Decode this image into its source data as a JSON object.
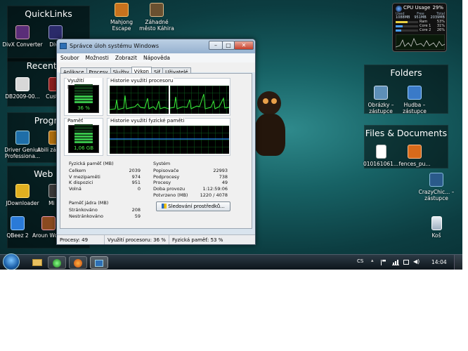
{
  "desktop": {
    "fences": {
      "quicklinks": "QuickLinks",
      "recent": "Recent Th",
      "programs": "Progra",
      "weblinks": "Web Li",
      "folders": "Folders",
      "files": "Files & Documents"
    },
    "icons": {
      "divx_converter": "DivX Converter",
      "divx2": "DivX",
      "mahjong": "Mahjong Escape",
      "zahadne": "Záhadné město Káhira",
      "db2009": "DB2009-00...",
      "custom": "Cust Fe",
      "driver_genius": "Driver Genius Professiona...",
      "abil": "Abili zástupce",
      "jdownloader": "JDownloader",
      "mi_fir": "Mi Fir",
      "qbeez": "QBeez 2",
      "around": "Aroun World",
      "obrazky": "Obrázky – zástupce",
      "hudba": "Hudba – zástupce",
      "file010": "010161061...",
      "fences_pu": "fences_pu...",
      "crazychic": "CrazyChic... – zástupce",
      "kos": "Koš"
    }
  },
  "cpu_gadget": {
    "title": "CPU Usage",
    "total_pct": "29%",
    "used_label": "Used",
    "free_label": "Free",
    "total_label": "Total",
    "used_val": "1088MB",
    "free_val": "951MB",
    "total_val": "2039MB",
    "ram_label": "Ram",
    "ram_pct": "53%",
    "core1_label": "Core 1",
    "core1_pct": "31%",
    "core2_label": "Core 2",
    "core2_pct": "26%",
    "ram_fill": 0.53,
    "core1_fill": 0.31,
    "core2_fill": 0.26
  },
  "window": {
    "title": "Správce úloh systému Windows",
    "menu": [
      "Soubor",
      "Možnosti",
      "Zobrazit",
      "Nápověda"
    ],
    "tabs": [
      "Aplikace",
      "Procesy",
      "Služby",
      "Výkon",
      "Síť",
      "Uživatelé"
    ],
    "active_tab": "Výkon",
    "groups": {
      "cpu_usage": "Využití procesoru",
      "cpu_history": "Historie využití procesoru",
      "memory": "Paměť",
      "mem_history": "Historie využití fyzické paměti"
    },
    "cpu_value": "36 %",
    "mem_value": "1,06 GB",
    "cpu_fill": 0.36,
    "mem_fill": 0.53,
    "physical": {
      "header": "Fyzická paměť (MB)",
      "rows": [
        {
          "label": "Celkem",
          "value": "2039"
        },
        {
          "label": "V mezipaměti",
          "value": "974"
        },
        {
          "label": "K dispozici",
          "value": "951"
        },
        {
          "label": "Volná",
          "value": "0"
        }
      ]
    },
    "kernel": {
      "header": "Paměť jádra (MB)",
      "rows": [
        {
          "label": "Stránkováno",
          "value": "208"
        },
        {
          "label": "Nestránkováno",
          "value": "59"
        }
      ]
    },
    "system": {
      "header": "Systém",
      "rows": [
        {
          "label": "Popisovače",
          "value": "22993"
        },
        {
          "label": "Podprocesy",
          "value": "738"
        },
        {
          "label": "Procesy",
          "value": "49"
        },
        {
          "label": "Doba provozu",
          "value": "1:12:59:06"
        },
        {
          "label": "Potvrzeno (MB)",
          "value": "1220 / 4078"
        }
      ]
    },
    "monitor_button": "Sledování prostředků...",
    "status": {
      "processes": "Procesy: 49",
      "cpu": "Využití procesoru: 36 %",
      "memory": "Fyzická paměť: 53 %"
    }
  },
  "taskbar": {
    "lang": "CS",
    "clock": "14:04"
  }
}
